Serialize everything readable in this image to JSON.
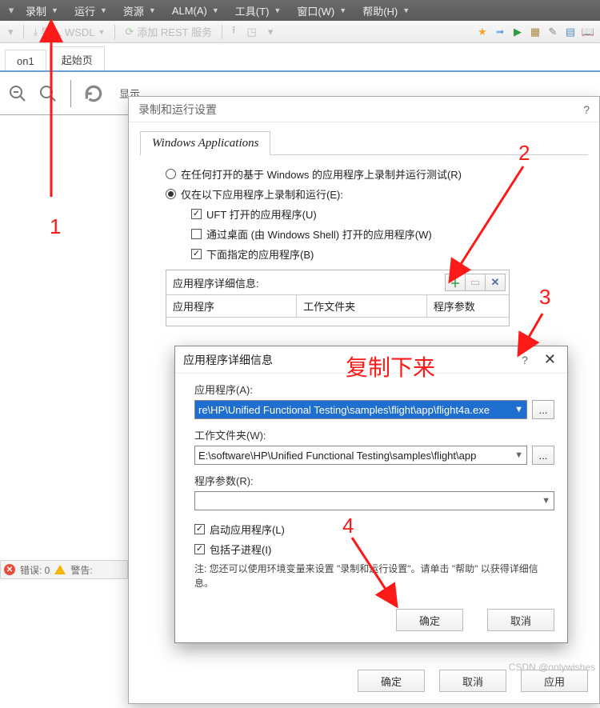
{
  "menubar": {
    "items": [
      "录制",
      "运行",
      "资源",
      "ALM(A)",
      "工具(T)",
      "窗口(W)",
      "帮助(H)"
    ]
  },
  "toolbar": {
    "import_wsdl": "导入 WSDL",
    "add_rest": "添加 REST 服务"
  },
  "doc_tabs": {
    "tab1": "on1",
    "tab2": "起始页"
  },
  "subbar": {
    "show_label": "显示"
  },
  "status": {
    "errors_label": "错误: 0",
    "warnings_label": "警告:"
  },
  "record_dialog": {
    "title": "录制和运行设置",
    "help": "?",
    "tab": "Windows Applications",
    "radio_any": "在任何打开的基于 Windows 的应用程序上录制并运行测试(R)",
    "radio_only": "仅在以下应用程序上录制和运行(E):",
    "chk_uft": "UFT 打开的应用程序(U)",
    "chk_shell": "通过桌面 (由 Windows Shell) 打开的应用程序(W)",
    "chk_below": "下面指定的应用程序(B)",
    "app_details_header": "应用程序详细信息:",
    "col_app": "应用程序",
    "col_folder": "工作文件夹",
    "col_args": "程序参数",
    "ok": "确定",
    "cancel": "取消",
    "apply": "应用"
  },
  "app_dialog": {
    "title": "应用程序详细信息",
    "help": "?",
    "app_label": "应用程序(A):",
    "app_value": "re\\HP\\Unified Functional Testing\\samples\\flight\\app\\flight4a.exe",
    "folder_label": "工作文件夹(W):",
    "folder_value": "E:\\software\\HP\\Unified Functional Testing\\samples\\flight\\app",
    "args_label": "程序参数(R):",
    "args_value": "",
    "chk_launch": "启动应用程序(L)",
    "chk_child": "包括子进程(I)",
    "note": "注: 您还可以使用环境变量来设置 \"录制和运行设置\"。请单击 \"帮助\" 以获得详细信息。",
    "ok": "确定",
    "cancel": "取消",
    "browse": "..."
  },
  "annotations": {
    "n1": "1",
    "n2": "2",
    "n3": "3",
    "n4": "4",
    "copy_text": "复制下来"
  },
  "watermark": "CSDN @onlywishes"
}
